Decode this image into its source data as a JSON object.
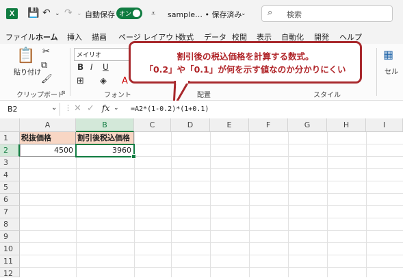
{
  "titlebar": {
    "autosave_label": "自動保存",
    "toggle_label": "オン",
    "filename": "sample… • 保存済み",
    "search_placeholder": "検索"
  },
  "tabs": [
    "ファイル",
    "ホーム",
    "挿入",
    "描画",
    "ページ レイアウト",
    "数式",
    "データ",
    "校閲",
    "表示",
    "自動化",
    "開発",
    "ヘルプ"
  ],
  "active_tab": "ホーム",
  "ribbon": {
    "paste_label": "貼り付け",
    "clipboard_group": "クリップボード",
    "font_name": "メイリオ",
    "font_group": "フォント",
    "align_group": "配置",
    "style_group": "スタイル",
    "cell_label": "セル"
  },
  "callout": {
    "line1": "割引後の税込価格を計算する数式。",
    "line2": "「0.2」や「0.1」が何を示す値なのか分かりにくい"
  },
  "formula_bar": {
    "name_box": "B2",
    "fx": "fx",
    "formula": "=A2*(1-0.2)*(1+0.1)"
  },
  "sheet": {
    "columns": [
      "A",
      "B",
      "C",
      "D",
      "E",
      "F",
      "G",
      "H",
      "I"
    ],
    "rows": [
      "1",
      "2",
      "3",
      "4",
      "5",
      "6",
      "7",
      "8",
      "9",
      "10",
      "11",
      "12"
    ],
    "a1": "税抜価格",
    "b1": "割引後税込価格",
    "a2": "4500",
    "b2": "3960"
  },
  "colors": {
    "accent": "#107c41",
    "callout": "#a8282c",
    "header_fill": "#f8d6c4"
  }
}
